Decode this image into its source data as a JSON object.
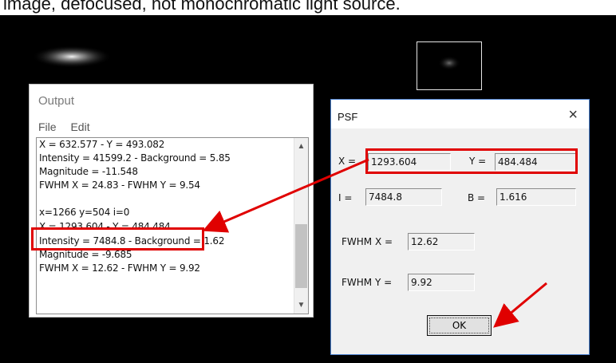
{
  "caption": "image, defocused, not monochromatic light source.",
  "output": {
    "title": "Output",
    "menu": [
      "File",
      "Edit"
    ],
    "lines": [
      "X = 632.577  -  Y = 493.082",
      "Intensity = 41599.2  -  Background = 5.85",
      "Magnitude = -11.548",
      "FWHM X = 24.83  -  FWHM Y = 9.54",
      "",
      "x=1266  y=504   i=0",
      "X = 1293.604  -  Y = 484.484",
      "Intensity = 7484.8  -  Background = 1.62",
      "Magnitude = -9.685",
      "FWHM X = 12.62  -  FWHM Y = 9.92"
    ]
  },
  "psf": {
    "title": "PSF",
    "close": "×",
    "x_label": "X =",
    "x_value": "1293.604",
    "y_label": "Y =",
    "y_value": "484.484",
    "i_label": "I =",
    "i_value": "7484.8",
    "b_label": "B =",
    "b_value": "1.616",
    "fwhmx_label": "FWHM X =",
    "fwhmx_value": "12.62",
    "fwhmy_label": "FWHM Y =",
    "fwhmy_value": "9.92",
    "ok_label": "OK"
  },
  "icons": {
    "scroll_up": "scroll-up-arrow-icon",
    "scroll_down": "scroll-down-arrow-icon"
  },
  "colors": {
    "highlight": "#e00000",
    "dialog_border": "#4a7fcc"
  }
}
